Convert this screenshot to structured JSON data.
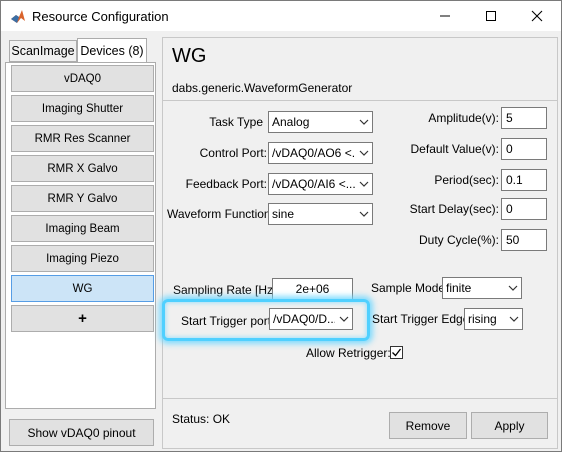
{
  "window": {
    "title": "Resource Configuration"
  },
  "tabs": [
    {
      "label": "ScanImage"
    },
    {
      "label": "Devices (8)"
    }
  ],
  "devices": [
    {
      "label": "vDAQ0"
    },
    {
      "label": "Imaging Shutter"
    },
    {
      "label": "RMR Res Scanner"
    },
    {
      "label": "RMR X Galvo"
    },
    {
      "label": "RMR Y Galvo"
    },
    {
      "label": "Imaging Beam"
    },
    {
      "label": "Imaging Piezo"
    },
    {
      "label": "WG"
    },
    {
      "label": "+"
    }
  ],
  "selected_device": "WG",
  "show_pinout_label": "Show vDAQ0 pinout",
  "panel": {
    "title": "WG",
    "class_name": "dabs.generic.WaveformGenerator"
  },
  "form": {
    "task_type": {
      "label": "Task Type",
      "value": "Analog"
    },
    "control_port": {
      "label": "Control Port:",
      "value": "/vDAQ0/AO6 <..."
    },
    "feedback_port": {
      "label": "Feedback Port:",
      "value": "/vDAQ0/AI6 <..."
    },
    "waveform_function": {
      "label": "Waveform Function:",
      "value": "sine"
    },
    "amplitude": {
      "label": "Amplitude(v):",
      "value": "5"
    },
    "default_value": {
      "label": "Default Value(v):",
      "value": "0"
    },
    "period": {
      "label": "Period(sec):",
      "value": "0.1"
    },
    "start_delay": {
      "label": "Start Delay(sec):",
      "value": "0"
    },
    "duty_cycle": {
      "label": "Duty Cycle(%):",
      "value": "50"
    },
    "sampling_rate": {
      "label": "Sampling Rate [Hz]:",
      "value": "2e+06"
    },
    "sample_mode": {
      "label": "Sample Mode:",
      "value": "finite"
    },
    "start_trigger_port": {
      "label": "Start Trigger port:",
      "value": "/vDAQ0/D..."
    },
    "start_trigger_edge": {
      "label": "Start Trigger Edge:",
      "value": "rising"
    },
    "allow_retrigger": {
      "label": "Allow Retrigger:",
      "checked": true
    }
  },
  "status": "Status: OK",
  "buttons": {
    "remove": "Remove",
    "apply": "Apply"
  },
  "colors": {
    "selection": "#cce4f7",
    "highlight_glow": "#4fd0ff",
    "app_icon": "#d9632b"
  }
}
